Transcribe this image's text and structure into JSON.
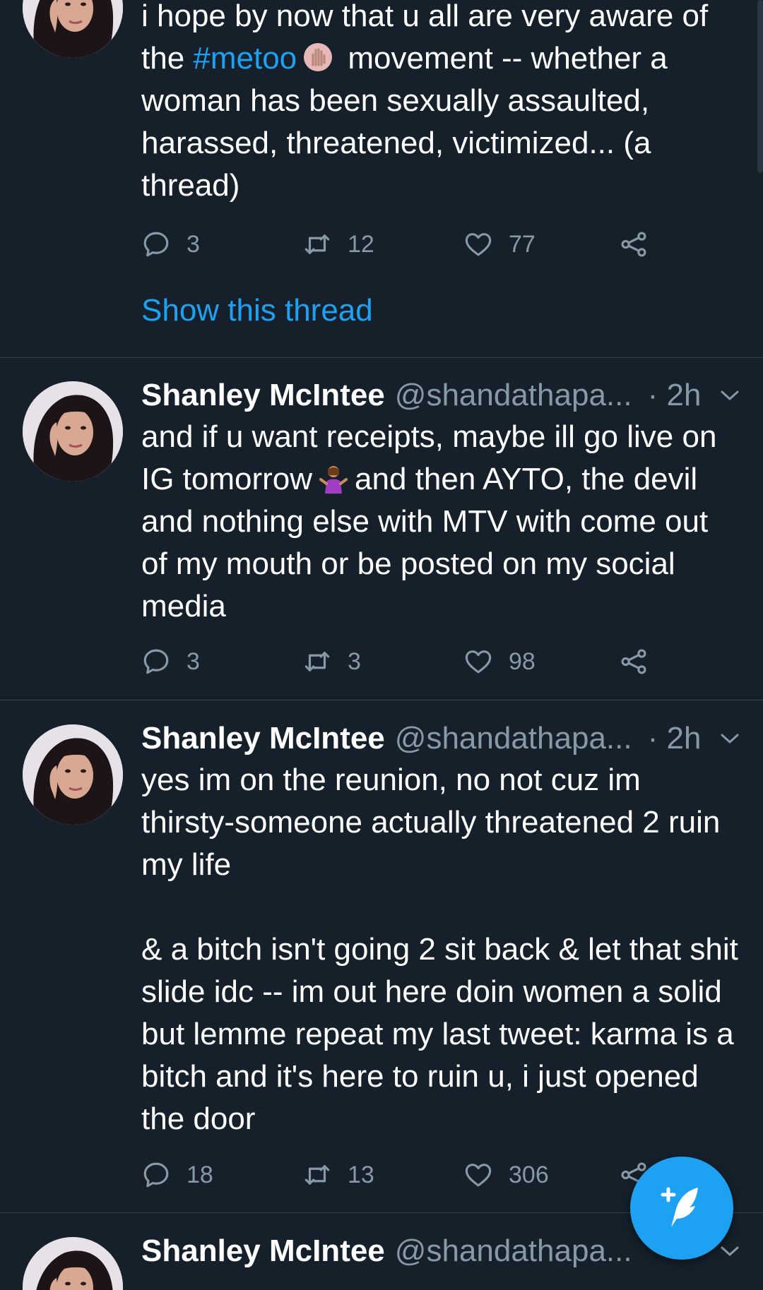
{
  "tweets": [
    {
      "text_before_hashtag": "i hope by now that u all are very aware of the ",
      "hashtag": "#metoo",
      "emoji_1": "raised-hand-emoji",
      "text_after_emoji": " movement -- whether a woman has been sexually assaulted, harassed, threatened, victimized... (a thread)",
      "reply_count": "3",
      "retweet_count": "12",
      "like_count": "77",
      "show_thread": "Show this thread"
    },
    {
      "name": "Shanley McIntee",
      "handle": "@shandathapa...",
      "time": "· 2h",
      "text_before_emoji": "and if u want receipts, maybe ill go live on IG tomorrow",
      "emoji_1": "person-shrugging-emoji",
      "text_after_emoji": "and then AYTO, the devil and nothing else with MTV with come out of my mouth or be posted on my social media",
      "reply_count": "3",
      "retweet_count": "3",
      "like_count": "98"
    },
    {
      "name": "Shanley McIntee",
      "handle": "@shandathapa...",
      "time": "· 2h",
      "para_1": "yes im on the reunion, no not cuz im thirsty-someone actually threatened 2 ruin my life",
      "para_2": "& a bitch isn't going 2 sit back & let that shit slide idc -- im out here doin women a solid but lemme repeat my last tweet: karma is a bitch and it's here to ruin u, i just opened the door",
      "reply_count": "18",
      "retweet_count": "13",
      "like_count": "306"
    },
    {
      "name": "Shanley McIntee",
      "handle": "@shandathapa..."
    }
  ],
  "colors": {
    "background": "#15202b",
    "accent": "#1da1f2",
    "secondary_text": "#8899a6",
    "divider": "#38444d"
  },
  "icons": {
    "reply": "reply-icon",
    "retweet": "retweet-icon",
    "like": "like-icon",
    "share": "share-icon",
    "compose": "compose-tweet-icon"
  }
}
